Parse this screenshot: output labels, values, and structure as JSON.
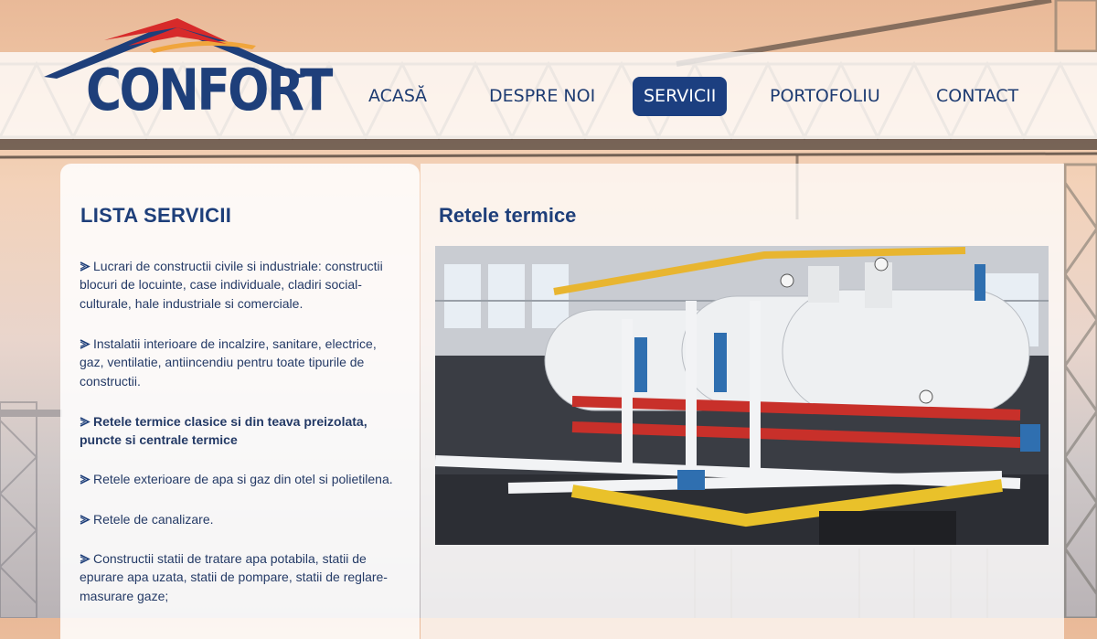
{
  "brand": {
    "name": "CONFORT",
    "colors": {
      "navy": "#1e3f7a",
      "red": "#d72a2a",
      "orange": "#f0a53c"
    }
  },
  "nav": {
    "items": [
      {
        "label": "ACASĂ",
        "active": false
      },
      {
        "label": "DESPRE NOI",
        "active": false
      },
      {
        "label": "SERVICII",
        "active": true
      },
      {
        "label": "PORTOFOLIU",
        "active": false
      },
      {
        "label": "CONTACT",
        "active": false
      }
    ]
  },
  "sidebar": {
    "title": "LISTA SERVICII",
    "bullet_icon": "arrow-bullet-icon",
    "items": [
      {
        "text": "Lucrari de constructii civile si industriale: constructii blocuri de locuinte, case individuale, cladiri social-culturale, hale industriale si comerciale.",
        "bold": false
      },
      {
        "text": "Instalatii interioare de incalzire, sanitare, electrice, gaz, ventilatie, antiincendiu pentru toate tipurile de constructii.",
        "bold": false
      },
      {
        "text": "Retele termice clasice si din teava preizolata, puncte si centrale termice",
        "bold": true
      },
      {
        "text": "Retele exterioare de apa si gaz din otel si polietilena.",
        "bold": false
      },
      {
        "text": "Retele de canalizare.",
        "bold": false
      },
      {
        "text": "Constructii statii de tratare apa potabila, statii de epurare apa uzata, statii de pompare, statii de reglare-masurare gaze;",
        "bold": false
      }
    ]
  },
  "main": {
    "title": "Retele termice"
  }
}
